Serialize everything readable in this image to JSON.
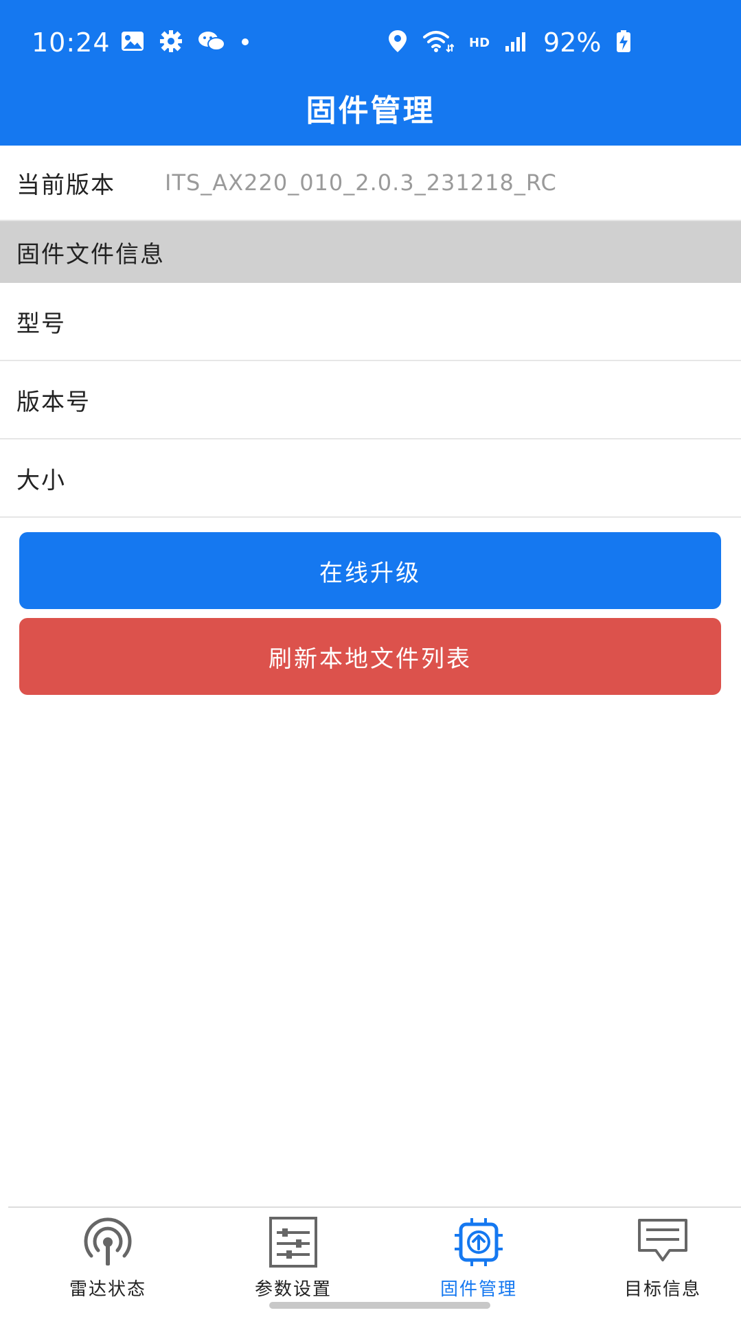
{
  "colors": {
    "primary": "#1578f0",
    "danger": "#dc524c",
    "section_bg": "#d0d0d0",
    "muted_text": "#9a9a9a"
  },
  "status_bar": {
    "time": "10:24",
    "battery_percent": "92%",
    "network_badge": "HD",
    "icons_left": [
      "image-icon",
      "gear-icon",
      "wechat-icon",
      "dot-icon"
    ],
    "icons_right": [
      "location-icon",
      "wifi-icon",
      "hd-icon",
      "signal-icon",
      "battery-charging-icon"
    ]
  },
  "header": {
    "title": "固件管理"
  },
  "current_version": {
    "label": "当前版本",
    "value": "ITS_AX220_010_2.0.3_231218_RC"
  },
  "firmware_info": {
    "section_title": "固件文件信息",
    "rows": [
      {
        "label": "型号",
        "value": ""
      },
      {
        "label": "版本号",
        "value": ""
      },
      {
        "label": "大小",
        "value": ""
      }
    ]
  },
  "actions": {
    "online_upgrade": "在线升级",
    "refresh_list": "刷新本地文件列表"
  },
  "bottom_nav": {
    "active": "固件管理",
    "items": [
      {
        "label": "雷达状态",
        "icon": "radar-icon"
      },
      {
        "label": "参数设置",
        "icon": "sliders-icon"
      },
      {
        "label": "固件管理",
        "icon": "chip-upload-icon"
      },
      {
        "label": "目标信息",
        "icon": "message-icon"
      }
    ]
  }
}
